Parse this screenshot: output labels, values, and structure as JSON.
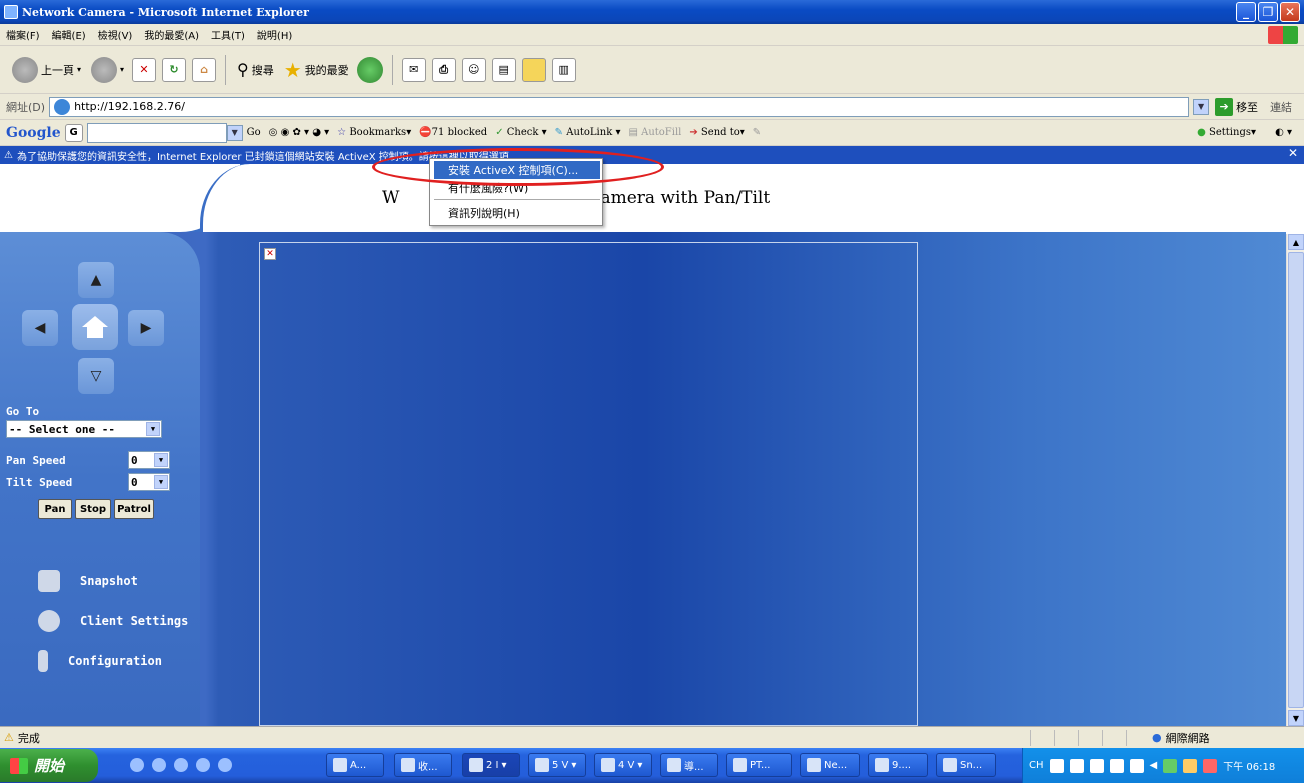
{
  "window": {
    "title": "Network Camera - Microsoft Internet Explorer"
  },
  "menu": [
    "檔案(F)",
    "編輯(E)",
    "檢視(V)",
    "我的最愛(A)",
    "工具(T)",
    "說明(H)"
  ],
  "toolbar": {
    "back": "上一頁",
    "search": "搜尋",
    "favorites": "我的最愛"
  },
  "address": {
    "label": "網址(D)",
    "url": "http://192.168.2.76/",
    "go": "移至",
    "links": "連結"
  },
  "googlebar": {
    "logo": "Google",
    "go": "Go",
    "bookmarks": "Bookmarks▾",
    "blocked": "71 blocked",
    "check": "Check ▾",
    "autolink": "AutoLink ▾",
    "autofill": "AutoFill",
    "sendto": "Send to▾",
    "settings": "Settings▾"
  },
  "infobar": {
    "text": "為了協助保護您的資訊安全性，Internet Explorer 已封鎖這個網站安裝 ActiveX 控制項。請按這裡以取得選項..."
  },
  "popup": {
    "item1": "安裝 ActiveX 控制項(C)...",
    "item2": "有什麼風險?(W)",
    "item3": "資訊列說明(H)"
  },
  "page": {
    "title_left": "W",
    "title_right": "Camera with Pan/Tilt"
  },
  "sidebar": {
    "goto_label": "Go To",
    "goto_select": "-- Select one --",
    "pan_speed_label": "Pan Speed",
    "pan_speed": "0",
    "tilt_speed_label": "Tilt Speed",
    "tilt_speed": "0",
    "pan": "Pan",
    "stop": "Stop",
    "patrol": "Patrol",
    "snapshot": "Snapshot",
    "client_settings": "Client Settings",
    "configuration": "Configuration"
  },
  "status": {
    "text": "完成",
    "zone": "網際網路"
  },
  "taskbar": {
    "start": "開始",
    "tasks": [
      "A...",
      "收...",
      "2 I",
      "5 V",
      "4 V",
      "導...",
      "PT...",
      "Ne...",
      "9....",
      "Sn..."
    ],
    "lang": "CH",
    "clock": "下午 06:18"
  }
}
